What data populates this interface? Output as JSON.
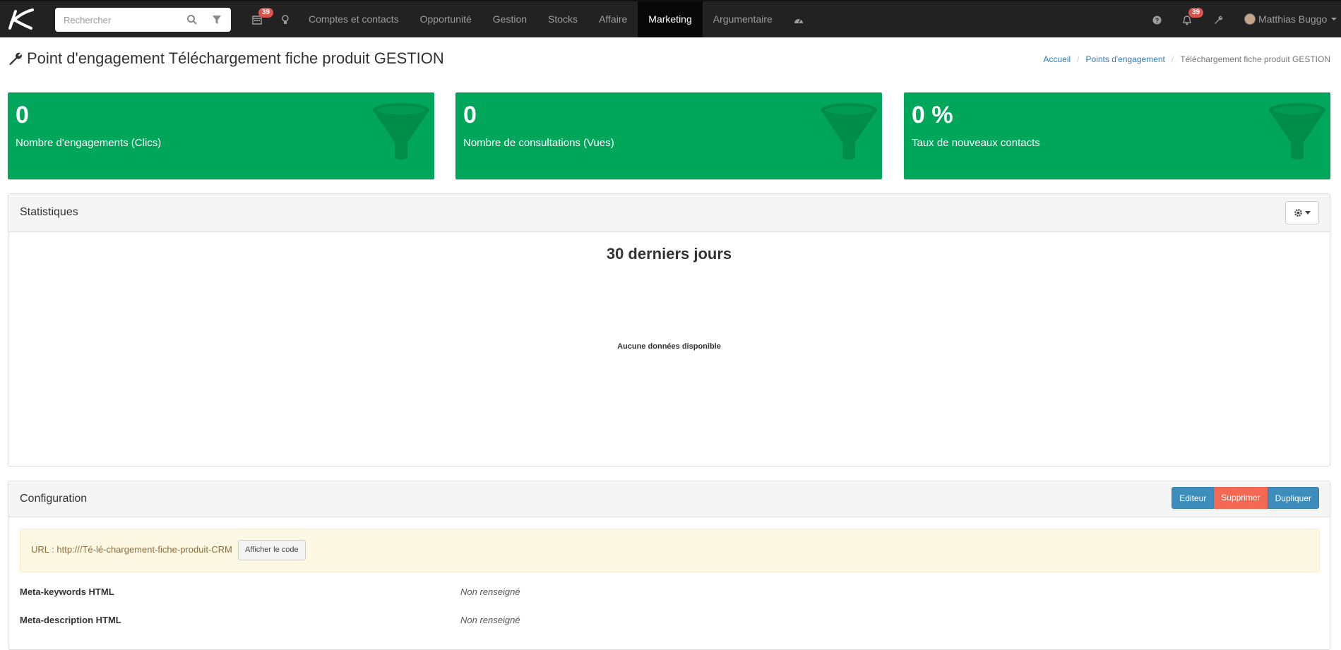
{
  "search": {
    "placeholder": "Rechercher"
  },
  "nav": {
    "calendar_badge": "39",
    "notifications_badge": "39",
    "links": [
      "Comptes et contacts",
      "Opportunité",
      "Gestion",
      "Stocks",
      "Affaire",
      "Marketing",
      "Argumentaire"
    ],
    "active": "Marketing",
    "user": "Matthias Buggo"
  },
  "page": {
    "title": "Point d'engagement Téléchargement fiche produit GESTION",
    "breadcrumb": [
      "Accueil",
      "Points d'engagement",
      "Téléchargement fiche produit GESTION"
    ]
  },
  "kpis": [
    {
      "value": "0",
      "label": "Nombre d'engagements (Clics)"
    },
    {
      "value": "0",
      "label": "Nombre de consultations (Vues)"
    },
    {
      "value": "0 %",
      "label": "Taux de nouveaux contacts"
    }
  ],
  "stats": {
    "title": "Statistiques",
    "chart_title": "30 derniers jours",
    "no_data": "Aucune données disponible"
  },
  "config": {
    "title": "Configuration",
    "buttons": {
      "edit": "Editeur",
      "delete": "Supprimer",
      "duplicate": "Dupliquer"
    },
    "url_text": "URL : http:///Té-lé-chargement-fiche-produit-CRM",
    "show_code": "Afficher le code",
    "meta": [
      {
        "key": "Meta-keywords HTML",
        "value": "Non renseigné"
      },
      {
        "key": "Meta-description HTML",
        "value": "Non renseigné"
      }
    ]
  },
  "colors": {
    "navbar": "#222222",
    "kpi_green": "#00a65a",
    "primary": "#3c8dbc",
    "danger": "#f56954"
  }
}
